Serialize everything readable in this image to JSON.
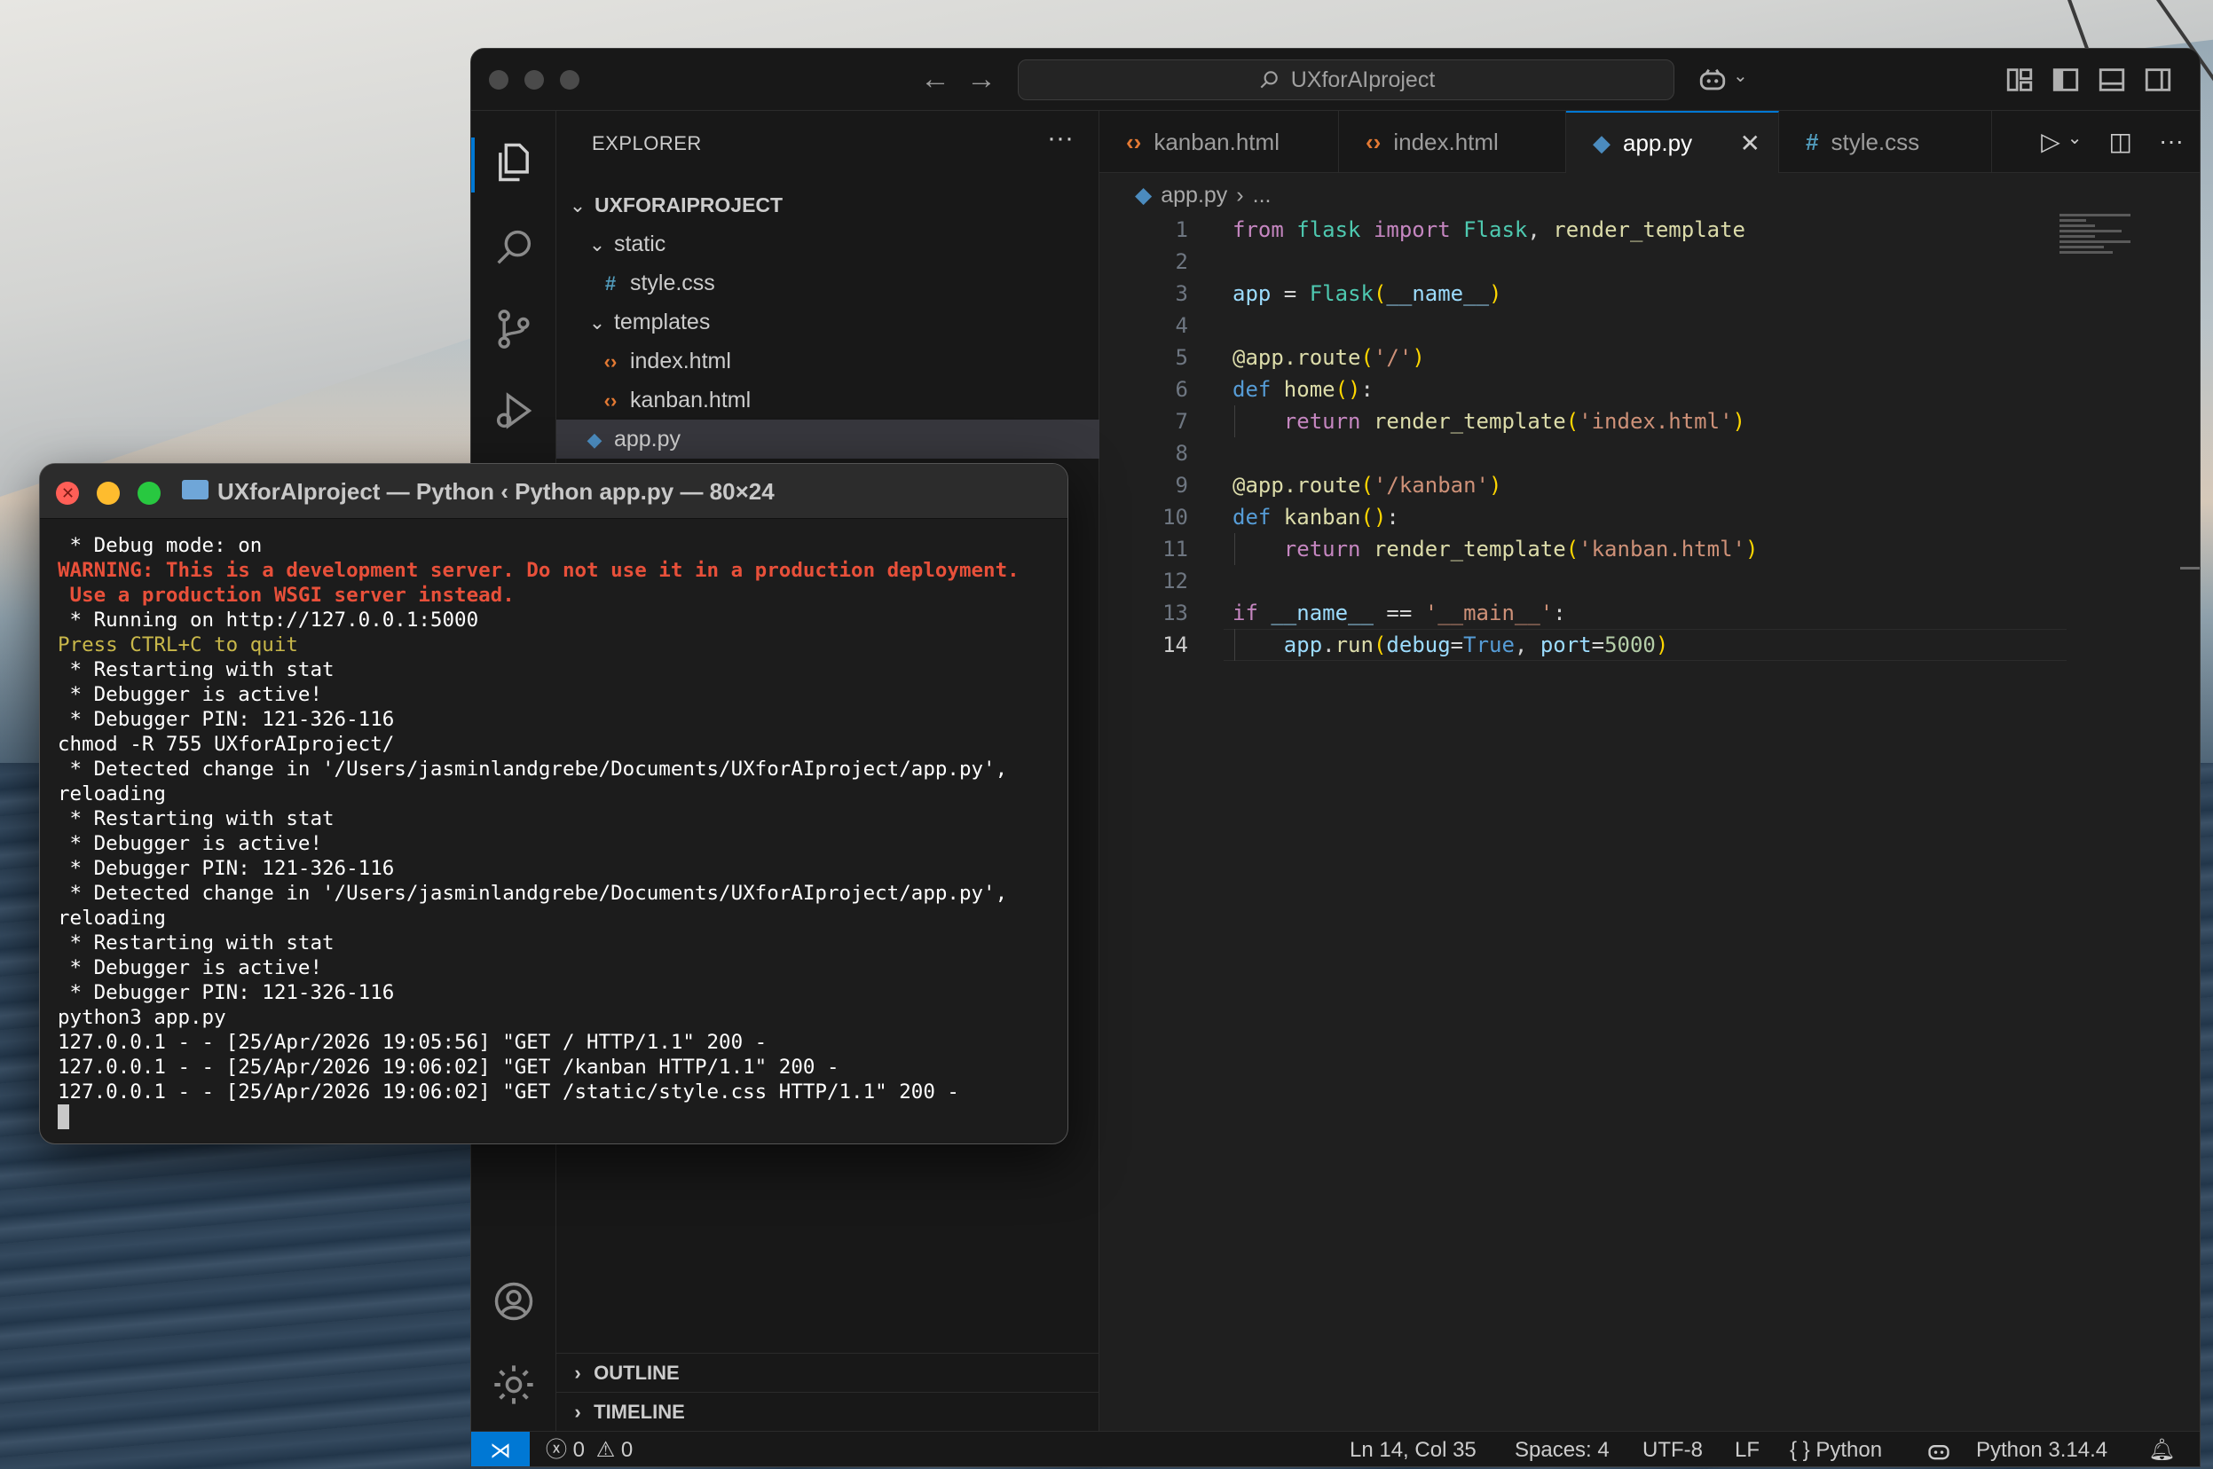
{
  "vscode": {
    "search_text": "UXforAIproject",
    "explorer": {
      "title": "EXPLORER",
      "more": "···",
      "project": "UXFORAIPROJECT",
      "tree": [
        {
          "label": "static",
          "icon": "chevron-down",
          "type": "folder"
        },
        {
          "label": "style.css",
          "icon": "#",
          "type": "css"
        },
        {
          "label": "templates",
          "icon": "chevron-down",
          "type": "folder"
        },
        {
          "label": "index.html",
          "icon": "<>",
          "type": "html"
        },
        {
          "label": "kanban.html",
          "icon": "<>",
          "type": "html"
        },
        {
          "label": "app.py",
          "icon": "python",
          "type": "py",
          "selected": true
        }
      ],
      "outline": "OUTLINE",
      "timeline": "TIMELINE"
    },
    "tabs": [
      {
        "label": "kanban.html",
        "icon": "<>"
      },
      {
        "label": "index.html",
        "icon": "<>"
      },
      {
        "label": "app.py",
        "icon": "python",
        "active": true
      },
      {
        "label": "style.css",
        "icon": "#"
      }
    ],
    "breadcrumb": {
      "file": "app.py",
      "rest": "..."
    },
    "code_lines": [
      [
        {
          "t": "from",
          "c": "kw2"
        },
        {
          "t": " flask ",
          "c": "cls"
        },
        {
          "t": "import",
          "c": "kw2"
        },
        {
          "t": " Flask",
          "c": "cls"
        },
        {
          "t": ", ",
          "c": "plain"
        },
        {
          "t": "render_template",
          "c": "fn"
        }
      ],
      [],
      [
        {
          "t": "app",
          "c": "var"
        },
        {
          "t": " = ",
          "c": "plain"
        },
        {
          "t": "Flask",
          "c": "cls"
        },
        {
          "t": "(",
          "c": "pn"
        },
        {
          "t": "__name__",
          "c": "var"
        },
        {
          "t": ")",
          "c": "pn"
        }
      ],
      [],
      [
        {
          "t": "@app.route",
          "c": "fn"
        },
        {
          "t": "(",
          "c": "pn"
        },
        {
          "t": "'/'",
          "c": "str"
        },
        {
          "t": ")",
          "c": "pn"
        }
      ],
      [
        {
          "t": "def",
          "c": "kw"
        },
        {
          "t": " home",
          "c": "fn"
        },
        {
          "t": "()",
          "c": "pn"
        },
        {
          "t": ":",
          "c": "plain"
        }
      ],
      [
        {
          "t": "    return",
          "c": "kw2"
        },
        {
          "t": " render_template",
          "c": "fn"
        },
        {
          "t": "(",
          "c": "pn"
        },
        {
          "t": "'index.html'",
          "c": "str"
        },
        {
          "t": ")",
          "c": "pn"
        }
      ],
      [],
      [
        {
          "t": "@app.route",
          "c": "fn"
        },
        {
          "t": "(",
          "c": "pn"
        },
        {
          "t": "'/kanban'",
          "c": "str"
        },
        {
          "t": ")",
          "c": "pn"
        }
      ],
      [
        {
          "t": "def",
          "c": "kw"
        },
        {
          "t": " kanban",
          "c": "fn"
        },
        {
          "t": "()",
          "c": "pn"
        },
        {
          "t": ":",
          "c": "plain"
        }
      ],
      [
        {
          "t": "    return",
          "c": "kw2"
        },
        {
          "t": " render_template",
          "c": "fn"
        },
        {
          "t": "(",
          "c": "pn"
        },
        {
          "t": "'kanban.html'",
          "c": "str"
        },
        {
          "t": ")",
          "c": "pn"
        }
      ],
      [],
      [
        {
          "t": "if",
          "c": "kw2"
        },
        {
          "t": " __name__",
          "c": "var"
        },
        {
          "t": " == ",
          "c": "plain"
        },
        {
          "t": "'__main__'",
          "c": "str"
        },
        {
          "t": ":",
          "c": "plain"
        }
      ],
      [
        {
          "t": "    app",
          "c": "var"
        },
        {
          "t": ".",
          "c": "plain"
        },
        {
          "t": "run",
          "c": "fn"
        },
        {
          "t": "(",
          "c": "pn"
        },
        {
          "t": "debug",
          "c": "var"
        },
        {
          "t": "=",
          "c": "plain"
        },
        {
          "t": "True",
          "c": "kw"
        },
        {
          "t": ", ",
          "c": "plain"
        },
        {
          "t": "port",
          "c": "var"
        },
        {
          "t": "=",
          "c": "plain"
        },
        {
          "t": "5000",
          "c": "num"
        },
        {
          "t": ")",
          "c": "pn"
        }
      ]
    ],
    "current_line": 14,
    "status": {
      "errors": "0",
      "warnings": "0",
      "position": "Ln 14, Col 35",
      "spaces": "Spaces: 4",
      "encoding": "UTF-8",
      "eol": "LF",
      "language": "Python",
      "interpreter": "Python 3.14.4"
    }
  },
  "terminal": {
    "title": "UXforAIproject — Python ‹ Python app.py — 80×24",
    "lines": [
      {
        "text": " * Debug mode: on",
        "style": "normal"
      },
      {
        "text": "WARNING: This is a development server. Do not use it in a production deployment.",
        "style": "warn"
      },
      {
        "text": " Use a production WSGI server instead.",
        "style": "warn"
      },
      {
        "text": " * Running on http://127.0.0.1:5000",
        "style": "normal"
      },
      {
        "text": "Press CTRL+C to quit",
        "style": "yellow"
      },
      {
        "text": " * Restarting with stat",
        "style": "normal"
      },
      {
        "text": " * Debugger is active!",
        "style": "normal"
      },
      {
        "text": " * Debugger PIN: 121-326-116",
        "style": "normal"
      },
      {
        "text": "chmod -R 755 UXforAIproject/",
        "style": "normal"
      },
      {
        "text": " * Detected change in '/Users/jasminlandgrebe/Documents/UXforAIproject/app.py',",
        "style": "normal"
      },
      {
        "text": "reloading",
        "style": "normal"
      },
      {
        "text": " * Restarting with stat",
        "style": "normal"
      },
      {
        "text": " * Debugger is active!",
        "style": "normal"
      },
      {
        "text": " * Debugger PIN: 121-326-116",
        "style": "normal"
      },
      {
        "text": " * Detected change in '/Users/jasminlandgrebe/Documents/UXforAIproject/app.py',",
        "style": "normal"
      },
      {
        "text": "reloading",
        "style": "normal"
      },
      {
        "text": " * Restarting with stat",
        "style": "normal"
      },
      {
        "text": " * Debugger is active!",
        "style": "normal"
      },
      {
        "text": " * Debugger PIN: 121-326-116",
        "style": "normal"
      },
      {
        "text": "python3 app.py",
        "style": "normal"
      },
      {
        "text": "127.0.0.1 - - [25/Apr/2026 19:05:56] \"GET / HTTP/1.1\" 200 -",
        "style": "normal"
      },
      {
        "text": "127.0.0.1 - - [25/Apr/2026 19:06:02] \"GET /kanban HTTP/1.1\" 200 -",
        "style": "normal"
      },
      {
        "text": "127.0.0.1 - - [25/Apr/2026 19:06:02] \"GET /static/style.css HTTP/1.1\" 200 -",
        "style": "normal"
      }
    ]
  },
  "colors": {
    "accent": "#0078d4",
    "warning_text": "#e8503a",
    "prompt_yellow": "#c9b84a",
    "traffic_red": "#ff5f57",
    "traffic_yellow": "#febc2e",
    "traffic_green": "#28c840"
  }
}
